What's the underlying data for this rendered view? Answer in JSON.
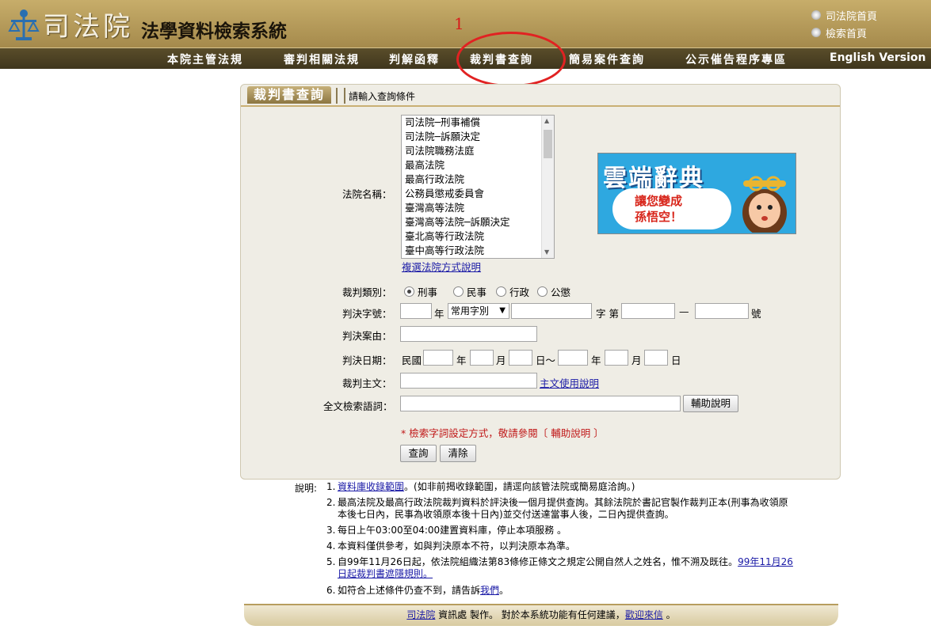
{
  "header": {
    "logo_text": "司法院",
    "system_title": "法學資料檢索系統",
    "top_links": [
      "司法院首頁",
      "檢索首頁"
    ],
    "annotation_number": "1"
  },
  "nav": {
    "items": [
      "本院主管法規",
      "審判相關法規",
      "判解函釋",
      "裁判書查詢",
      "簡易案件查詢",
      "公示催告程序專區",
      "English Version"
    ]
  },
  "panel": {
    "tab_label": "裁判書查詢",
    "hint": "請輸入查詢條件",
    "court_label": "法院名稱：",
    "courts": [
      "司法院─刑事補償",
      "司法院─訴願決定",
      "司法院職務法庭",
      "最高法院",
      "最高行政法院",
      "公務員懲戒委員會",
      "臺灣高等法院",
      "臺灣高等法院─訴願決定",
      "臺北高等行政法院",
      "臺中高等行政法院"
    ],
    "multi_select_help": "複選法院方式說明",
    "category_label": "裁判類別：",
    "categories": [
      "刑事",
      "民事",
      "行政",
      "公懲"
    ],
    "selected_category": "刑事",
    "case_no_label": "判決字號：",
    "year_suffix": "年",
    "common_word_select": "常用字別",
    "word_suffix": "字 第",
    "dash": "—",
    "number_suffix": "號",
    "reason_label": "判決案由：",
    "date_label": "判決日期：",
    "era": "民國",
    "y": "年",
    "m": "月",
    "d_to": "日～",
    "d": "日",
    "main_text_label": "裁判主文：",
    "main_text_help": "主文使用說明",
    "fulltext_label": "全文檢索語詞：",
    "help_button": "輔助說明",
    "warning": "* 檢索字詞設定方式，敬請參閱〔 輔助說明 〕",
    "search_button": "查詢",
    "clear_button": "清除"
  },
  "ad": {
    "title": "雲端辭典",
    "line1": "讓您變成",
    "line2": "孫悟空！"
  },
  "notes": {
    "label": "說明:",
    "items": [
      {
        "num": "1.",
        "link": "資料庫收錄範圍",
        "text": "。(如非前揭收錄範圍，請逕向該管法院或簡易庭洽詢。)"
      },
      {
        "num": "2.",
        "text": "最高法院及最高行政法院裁判資料於評決後一個月提供查詢。其餘法院於書記官製作裁判正本(刑事為收領原本後七日內，民事為收領原本後十日內)並交付送達當事人後，二日內提供查詢。"
      },
      {
        "num": "3.",
        "text": "每日上午03:00至04:00建置資料庫，停止本項服務 。"
      },
      {
        "num": "4.",
        "text": "本資料僅供參考，如與判決原本不符，以判決原本為準。"
      },
      {
        "num": "5.",
        "text": "自99年11月26日起，依法院組織法第83條修正條文之規定公開自然人之姓名，惟不溯及既往。",
        "link": "99年11月26日起裁判書遮隱規則。"
      },
      {
        "num": "6.",
        "text": "如符合上述條件仍查不到，請告訴",
        "link": "我們",
        "tail": "。"
      }
    ]
  },
  "footer": {
    "link1": "司法院",
    "text1": " 資訊處 製作。 對於本系統功能有任何建議，",
    "link2": "歡迎來信",
    "text2": " 。"
  }
}
